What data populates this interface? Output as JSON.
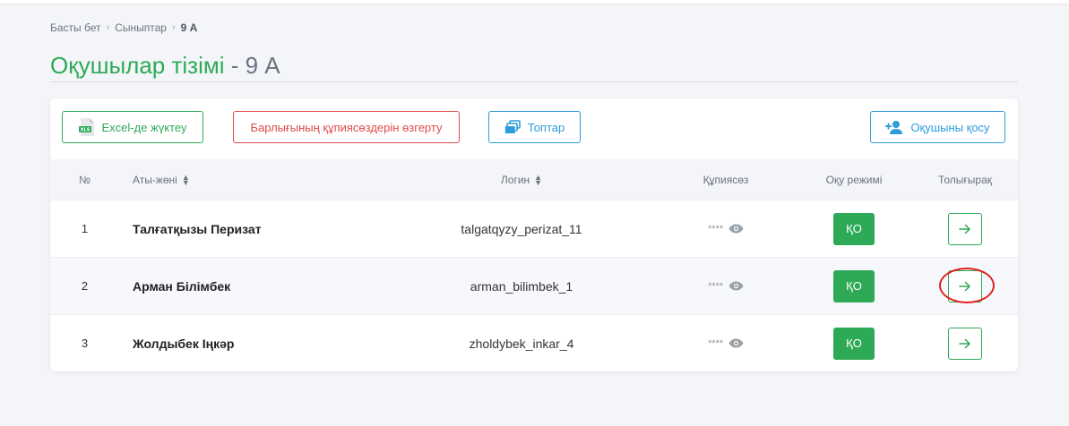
{
  "breadcrumb": {
    "home": "Басты бет",
    "classes": "Сыныптар",
    "current": "9 А"
  },
  "page": {
    "title_main": "Оқушылар тізімі",
    "title_sep": " - ",
    "title_class": "9 А"
  },
  "toolbar": {
    "excel_label": "Excel-де жүктеу",
    "reset_passwords_label": "Барлығының құпиясөздерін өзгерту",
    "groups_label": "Топтар",
    "add_student_label": "Оқушыны қосу"
  },
  "table": {
    "headers": {
      "num": "№",
      "name": "Аты-жөні",
      "login": "Логин",
      "password": "Құпиясөз",
      "mode": "Оқу режимі",
      "more": "Толығырақ"
    },
    "rows": [
      {
        "num": "1",
        "name": "Талғатқызы Перизат",
        "login": "talgatqyzy_perizat_11",
        "password": "****",
        "mode": "ҚО"
      },
      {
        "num": "2",
        "name": "Арман Білімбек",
        "login": "arman_bilimbek_1",
        "password": "****",
        "mode": "ҚО"
      },
      {
        "num": "3",
        "name": "Жолдыбек Іңкәр",
        "login": "zholdybek_inkar_4",
        "password": "****",
        "mode": "ҚО"
      }
    ]
  },
  "colors": {
    "accent_green": "#2eaa57",
    "danger_red": "#e04b4b",
    "info_blue": "#2d9cdb"
  },
  "icons": {
    "excel": "xls-file-icon",
    "groups": "groups-icon",
    "add_user": "add-user-icon",
    "sort": "sort-icon",
    "eye": "eye-icon",
    "arrow": "arrow-right-icon"
  }
}
